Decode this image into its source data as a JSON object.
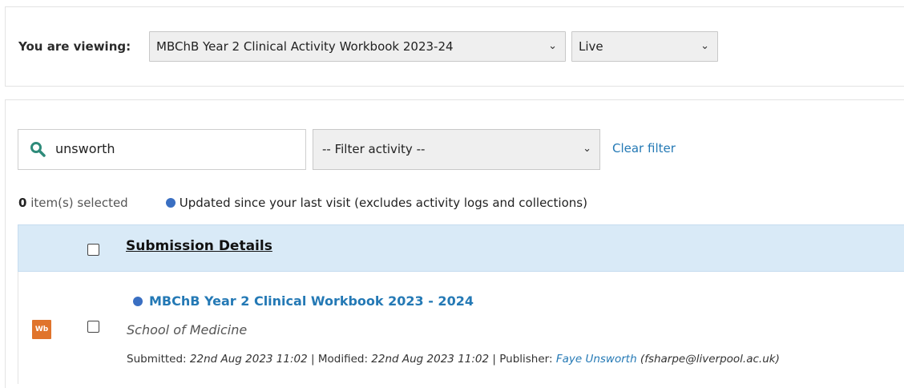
{
  "viewing": {
    "label": "You are viewing:",
    "workbook_select": "MBChB Year 2 Clinical Activity Workbook 2023-24",
    "status_select": "Live"
  },
  "filters": {
    "search_value": "unsworth",
    "activity_select": "-- Filter activity --",
    "clear_label": "Clear filter"
  },
  "selection": {
    "count": "0",
    "count_suffix": " item(s) selected",
    "legend": "Updated since your last visit (excludes activity logs and collections)"
  },
  "table": {
    "header": "Submission Details",
    "rows": [
      {
        "icon_label": "Wb",
        "title": "MBChB Year 2 Clinical Workbook 2023 - 2024",
        "school": "School of Medicine",
        "submitted_label": "Submitted: ",
        "submitted": "22nd Aug 2023 11:02",
        "modified_label": " | Modified: ",
        "modified": "22nd Aug 2023 11:02",
        "publisher_label": " | Publisher: ",
        "publisher": "Faye Unsworth",
        "email": "(fsharpe@liverpool.ac.uk)"
      }
    ]
  },
  "colors": {
    "link": "#2479b5",
    "header_bg": "#d9eaf7",
    "dot": "#3a6fc2",
    "workbook_icon": "#e0742c"
  }
}
